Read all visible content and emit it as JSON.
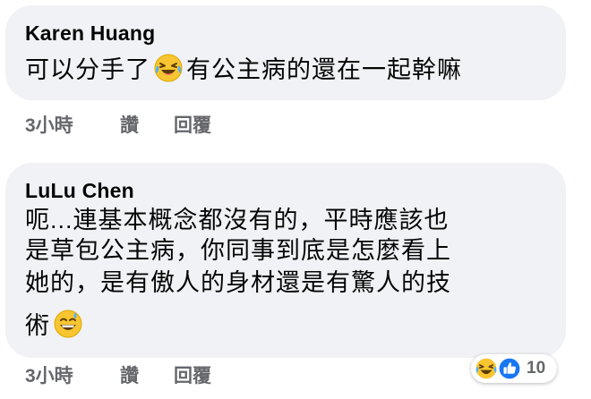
{
  "comments": [
    {
      "author": "Karen Huang",
      "text_before": "可以分手了",
      "emoji1": "laughing-tears-icon",
      "text_after": "有公主病的還在一起幹嘛",
      "time": "3小時",
      "like_label": "讚",
      "reply_label": "回覆"
    },
    {
      "author": "LuLu Chen",
      "lines": [
        "呃...連基本概念都沒有的，平時應該也",
        "是草包公主病，你同事到底是怎麼看上",
        "她的，是有傲人的身材還是有驚人的技",
        "術"
      ],
      "emoji1": "grinning-sweat-icon",
      "time": "3小時",
      "like_label": "讚",
      "reply_label": "回覆",
      "reactions": {
        "icons": [
          "laughing-tears-icon",
          "like-thumb-icon"
        ],
        "count": "10"
      }
    }
  ],
  "colors": {
    "bubble": "#f0f2f5",
    "meta_text": "#65676b",
    "like_blue": "#1877f2",
    "emoji_yellow": "#f7c531"
  }
}
